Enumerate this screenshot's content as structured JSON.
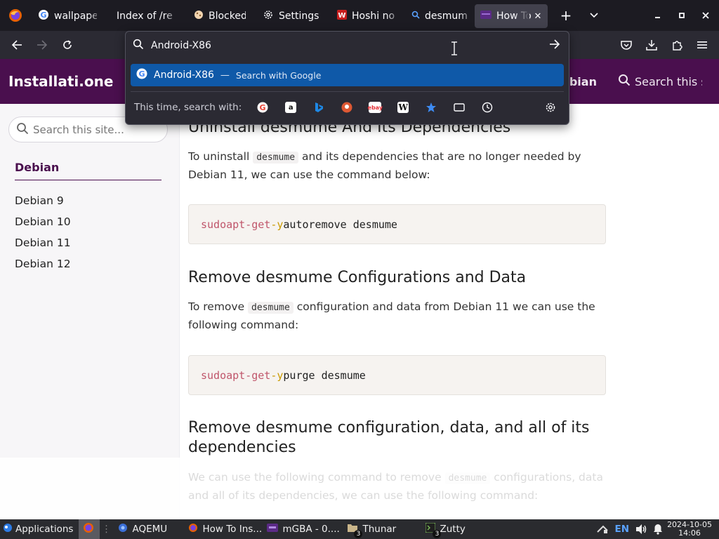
{
  "browser": {
    "tabs": [
      {
        "title": "wallpaper",
        "icon": "google-icon",
        "active": false
      },
      {
        "title": "Index of /rep",
        "icon": "none",
        "active": false
      },
      {
        "title": "Blocked",
        "icon": "cookie-icon",
        "active": false
      },
      {
        "title": "Settings",
        "icon": "gear-icon",
        "active": false
      },
      {
        "title": "Hoshi no",
        "icon": "wiki-icon",
        "active": false
      },
      {
        "title": "desmume",
        "icon": "search-icon",
        "active": false
      },
      {
        "title": "How To",
        "icon": "site-icon",
        "active": true
      }
    ]
  },
  "urlbar": {
    "value": "Android-X86",
    "suggestion_text": "Android-X86",
    "suggestion_hint": "Search with Google",
    "engines_label": "This time, search with:",
    "engines": [
      "google",
      "amazon",
      "bing",
      "duckduckgo",
      "ebay",
      "wikipedia",
      "bookmarks",
      "tabs",
      "history"
    ]
  },
  "site": {
    "brand": "Installati.one",
    "nav_debian": "ebian",
    "nav_search": "Search this s"
  },
  "sidebar": {
    "search_placeholder": "Search this site...",
    "title": "Debian",
    "items": [
      "Debian 9",
      "Debian 10",
      "Debian 11",
      "Debian 12"
    ]
  },
  "article": {
    "h_uninstall": "Uninstall desmume And Its Dependencies",
    "p_uninstall_a": "To uninstall",
    "p_uninstall_code": "desmume",
    "p_uninstall_b": "and its dependencies that are no longer needed by Debian 11, we can use the command below:",
    "code1": {
      "sudo": "sudo",
      "apt": "apt-get",
      "flag": "-y",
      "rest": "autoremove desmume"
    },
    "h_remove": "Remove desmume Configurations and Data",
    "p_remove_a": "To remove",
    "p_remove_code": "desmume",
    "p_remove_b": "configuration and data from Debian 11 we can use the following command:",
    "code2": {
      "sudo": "sudo",
      "apt": "apt-get",
      "flag": "-y",
      "rest": "purge desmume"
    },
    "h_all": "Remove desmume configuration, data, and all of its dependencies",
    "p_all_a": "We can use the following command to remove",
    "p_all_code": "desmume",
    "p_all_b": "configurations, data and all of its dependencies, we can use the following command:"
  },
  "taskbar": {
    "applications": "Applications",
    "items": [
      {
        "label": "AQEMU",
        "icon": "aqemu-icon"
      },
      {
        "label": "How To Ins...",
        "icon": "firefox-icon"
      },
      {
        "label": "mGBA - 0....",
        "icon": "mgba-icon"
      },
      {
        "label": "Thunar",
        "icon": "folder-icon",
        "badge": "3"
      },
      {
        "label": "Zutty",
        "icon": "terminal-icon",
        "badge": "3"
      }
    ],
    "lang": "EN",
    "date": "2024-10-05",
    "time": "14:06"
  },
  "colors": {
    "site_header": "#4a0f4e",
    "suggest_highlight": "#0f59a8",
    "browser_chrome": "#1c1b22"
  }
}
